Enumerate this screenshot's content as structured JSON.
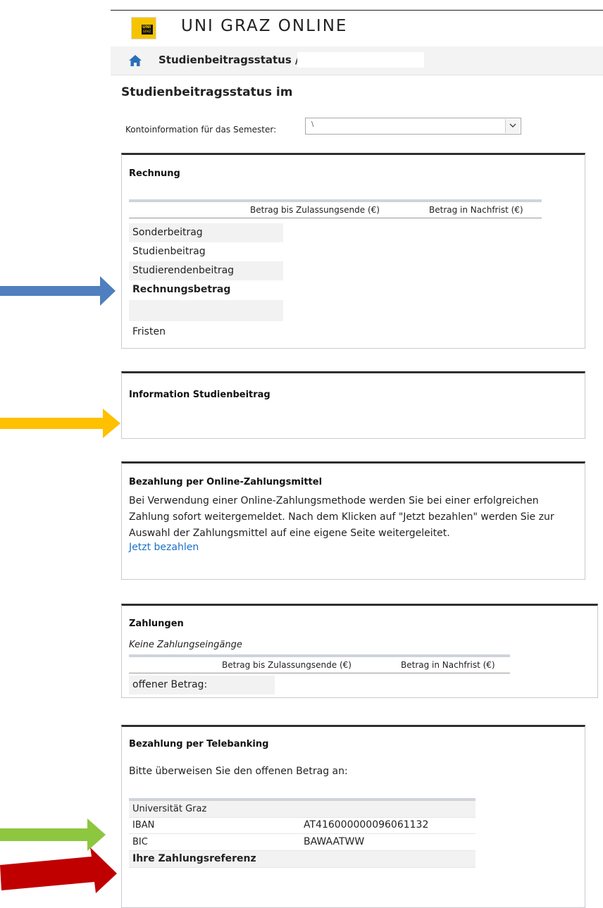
{
  "header": {
    "app_title": "UNI GRAZ ONLINE",
    "logo_text_top": "UNI",
    "logo_text_bottom": "GRAZ",
    "breadcrumb": "Studienbeitragsstatus / ",
    "brand_color": "#f5c400",
    "home_icon_color": "#2a6fba"
  },
  "page": {
    "title": "Studienbeitragsstatus im ",
    "semester_label": "Kontoinformation für das Semester:",
    "semester_value": "\\"
  },
  "rechnung": {
    "heading": "Rechnung",
    "columns": [
      "Betrag bis Zulassungsende (€)",
      "Betrag in Nachfrist (€)"
    ],
    "rows": [
      "Sonderbeitrag",
      "Studienbeitrag",
      "Studierendenbeitrag",
      "Rechnungsbetrag",
      "",
      "Fristen"
    ]
  },
  "info": {
    "heading": "Information Studienbeitrag"
  },
  "online": {
    "heading": "Bezahlung per Online-Zahlungsmittel",
    "text": "Bei Verwendung einer Online-Zahlungsmethode werden Sie bei einer erfolgreichen Zahlung sofort weitergemeldet. Nach dem Klicken auf \"Jetzt bezahlen\" werden Sie zur Auswahl der Zahlungsmittel auf eine eigene Seite weitergeleitet.",
    "link": "Jetzt bezahlen",
    "link_color": "#1a6fc9"
  },
  "zahlungen": {
    "heading": "Zahlungen",
    "empty_note": "Keine Zahlungseingänge",
    "columns": [
      "Betrag bis Zulassungsende (€)",
      "Betrag in Nachfrist (€)"
    ],
    "rows": [
      "offener Betrag:"
    ]
  },
  "telebanking": {
    "heading": "Bezahlung per Telebanking",
    "instruction": "Bitte überweisen Sie den offenen Betrag an:",
    "recipient": "Universität Graz",
    "iban_label": "IBAN",
    "iban_value": "AT416000000096061132",
    "bic_label": "BIC",
    "bic_value": "BAWAATWW",
    "reference_label": "Ihre Zahlungsreferenz"
  },
  "annotations": {
    "arrow_colors": [
      "#4f7fbf",
      "#ffc000",
      "#8dc63f",
      "#c00000"
    ]
  }
}
